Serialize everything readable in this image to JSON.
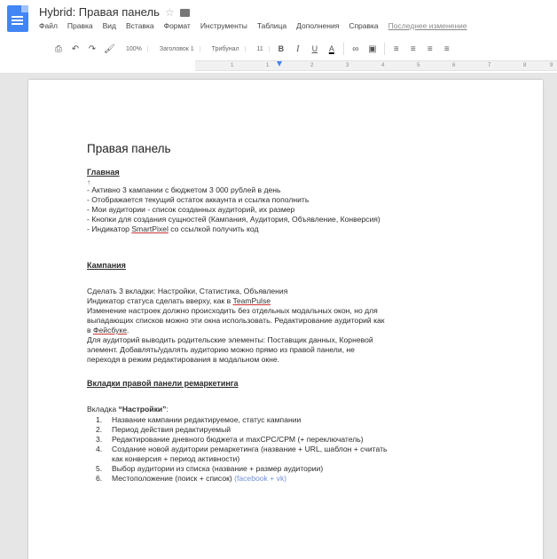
{
  "header": {
    "doc_title": "Hybrid: Правая панель",
    "star_icon": "star-icon",
    "folder_icon": "folder-icon"
  },
  "menu": {
    "items": [
      "Файл",
      "Правка",
      "Вид",
      "Вставка",
      "Формат",
      "Инструменты",
      "Таблица",
      "Дополнения",
      "Справка"
    ],
    "last_edit": "Последнее изменение"
  },
  "toolbar": {
    "zoom": "100%",
    "style": "Заголовок 1",
    "font": "Трибунал",
    "size": "11"
  },
  "ruler": {
    "marks": [
      "1",
      "1",
      "2",
      "3",
      "4",
      "5",
      "6",
      "7",
      "8",
      "9"
    ]
  },
  "document": {
    "title": "Правая панель",
    "main": {
      "heading": "Главная",
      "caret": "↑",
      "bullets": [
        "- Активно 3 кампании с бюджетом 3 000 рублей в день",
        "- Отображается текущий остаток аккаунта и ссылка пополнить",
        "- Мои аудитории - список созданных аудиторий, их размер",
        "- Кнопки для создания сущностей (Кампания, Аудитория, Объявление, Конверсия)"
      ],
      "bullet5_pre": "- Индикатор ",
      "bullet5_link": "SmartPixel",
      "bullet5_post": " со ссылкой получить код"
    },
    "campaign": {
      "heading": "Кампания",
      "line1": "Сделать 3 вкладки: Настройки, Статистика, Объявления",
      "line2_pre": "Индикатор статуса сделать вверху, как в ",
      "line2_link": "TeamPulse",
      "line3": "Изменение настроек должно происходить без отдельных модальных окон, но для",
      "line4": "выпадающих списков можно эти окна использовать. Редактирование аудиторий как",
      "line5_pre": "в ",
      "line5_link": "Фейсбуке",
      "line5_post": ".",
      "line6": "Для аудиторий выводить родительские элементы: Поставщик данных, Корневой",
      "line7": "элемент. Добавлять/удалять аудиторию можно прямо из правой панели, не",
      "line8": "переходя в режим редактирования в модальном окне."
    },
    "remarketing": {
      "heading": "Вкладки правой панели ремаркетинга",
      "tab_pre": "Вкладка ",
      "tab_name": "“Настройки”",
      "tab_post": ":",
      "items": [
        {
          "num": "1.",
          "text": "Название кампании редактируемое, статус кампании"
        },
        {
          "num": "2.",
          "text": "Период действия редактируемый"
        },
        {
          "num": "3.",
          "text": "Редактирование дневного бюджета и maxCPC/CPM (+ переключатель)"
        },
        {
          "num": "4.",
          "text": "Создание новой аудитории ремаркетинга (название + URL, шаблон + считать"
        },
        {
          "num": "",
          "text": "как конверсия + период активности)"
        },
        {
          "num": "5.",
          "text": "Выбор аудитории из списка (название + размер аудитории)"
        },
        {
          "num": "6.",
          "text": "Местоположение (поиск + список) "
        }
      ],
      "item6_faded": "(facebook + vk)"
    }
  }
}
